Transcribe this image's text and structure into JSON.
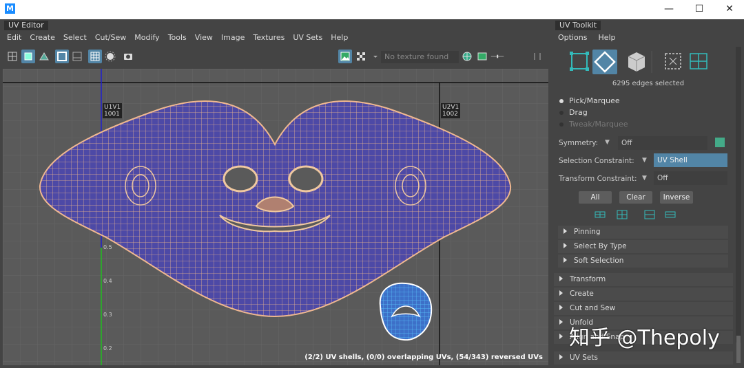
{
  "window": {
    "logo": "M",
    "minimize": "—",
    "maximize": "☐",
    "close": "✕"
  },
  "uv_editor": {
    "title": "UV Editor",
    "menus": [
      "Edit",
      "Create",
      "Select",
      "Cut/Sew",
      "Modify",
      "Tools",
      "View",
      "Image",
      "Textures",
      "UV Sets",
      "Help"
    ],
    "texture_field": "No texture found",
    "udims": [
      {
        "label": "U1V1",
        "id": "1001"
      },
      {
        "label": "U2V1",
        "id": "1002"
      }
    ],
    "axis_ticks": [
      "0.5",
      "0.4",
      "0.3",
      "0.2"
    ],
    "status_text": "(2/2) UV shells, (0/0) overlapping UVs, (54/343) reversed UVs"
  },
  "uv_toolkit": {
    "title": "UV Toolkit",
    "menus": [
      "Options",
      "Help"
    ],
    "selection_count": "6295 edges selected",
    "modes": [
      {
        "label": "Pick/Marquee",
        "selected": true,
        "enabled": true
      },
      {
        "label": "Drag",
        "selected": false,
        "enabled": true
      },
      {
        "label": "Tweak/Marquee",
        "selected": false,
        "enabled": false
      }
    ],
    "symmetry": {
      "label": "Symmetry:",
      "value": "Off"
    },
    "selection_constraint": {
      "label": "Selection Constraint:",
      "value": "UV Shell"
    },
    "transform_constraint": {
      "label": "Transform Constraint:",
      "value": "Off"
    },
    "buttons": [
      "All",
      "Clear",
      "Inverse"
    ],
    "subsections": [
      "Pinning",
      "Select By Type",
      "Soft Selection"
    ],
    "sections": [
      "Transform",
      "Create",
      "Cut and Sew",
      "Unfold",
      "Align and Snap",
      "UV Sets"
    ],
    "accent": "#5285a6"
  },
  "watermark": "知乎 @Thepoly"
}
